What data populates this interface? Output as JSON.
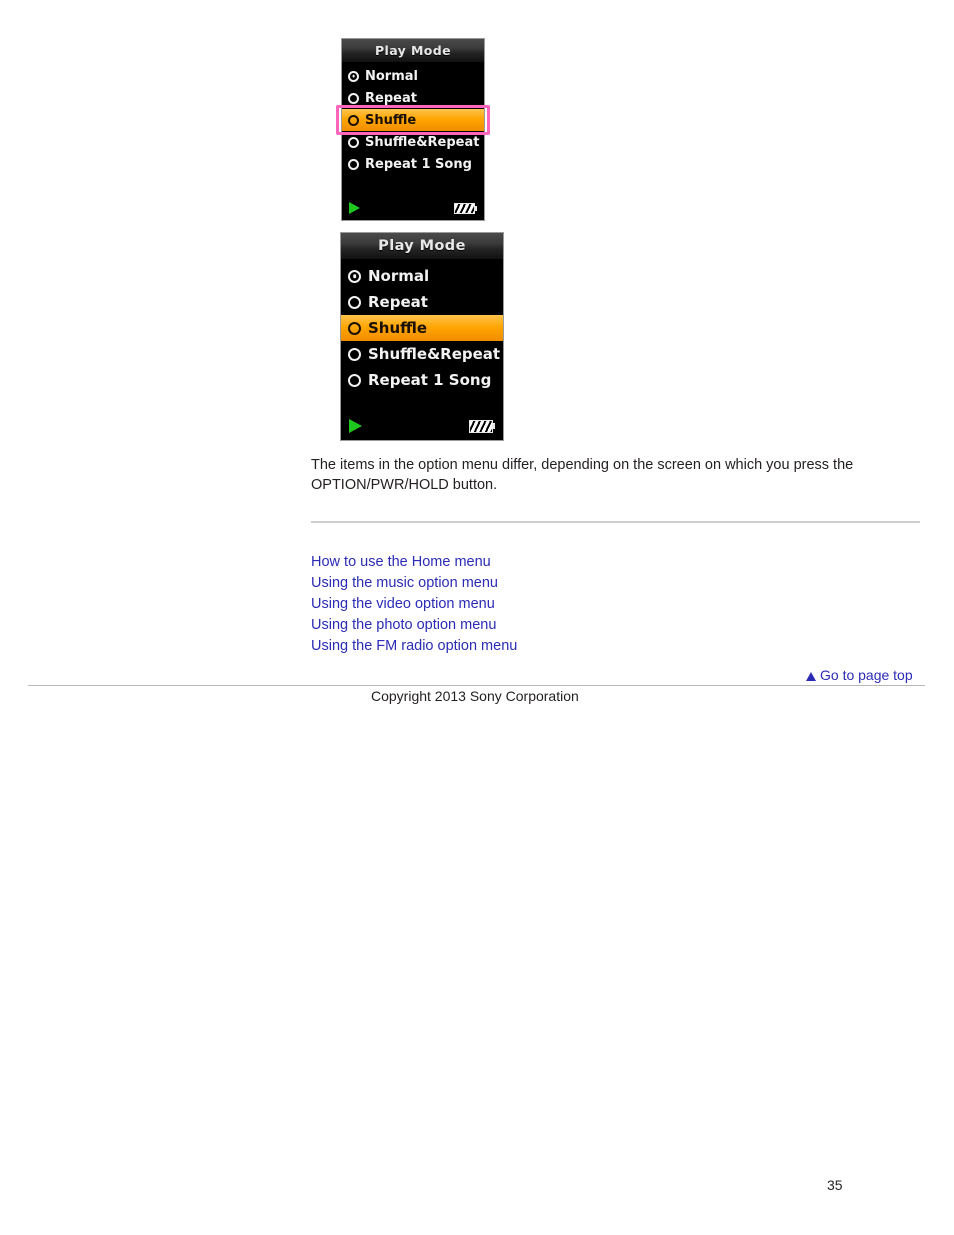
{
  "screens": [
    {
      "name": "play-mode-screen-highlighted",
      "title": "Play Mode",
      "items": [
        {
          "label": "Normal",
          "checked": true,
          "selected": false
        },
        {
          "label": "Repeat",
          "checked": false,
          "selected": false
        },
        {
          "label": "Shuffle",
          "checked": false,
          "selected": true
        },
        {
          "label": "Shuffle&Repeat",
          "checked": false,
          "selected": false
        },
        {
          "label": "Repeat 1 Song",
          "checked": false,
          "selected": false
        }
      ],
      "status": {
        "play_icon": "play-triangle-icon",
        "battery_icon": "battery-full-icon"
      },
      "callout_color": "#ff66bb"
    },
    {
      "name": "play-mode-screen-zoomed",
      "title": "Play Mode",
      "items": [
        {
          "label": "Normal",
          "checked": true,
          "selected": false
        },
        {
          "label": "Repeat",
          "checked": false,
          "selected": false
        },
        {
          "label": "Shuffle",
          "checked": false,
          "selected": true
        },
        {
          "label": "Shuffle&Repeat",
          "checked": false,
          "selected": false
        },
        {
          "label": "Repeat 1 Song",
          "checked": false,
          "selected": false
        }
      ],
      "status": {
        "play_icon": "play-triangle-icon",
        "battery_icon": "battery-full-icon"
      }
    }
  ],
  "note": {
    "line1": "The items in the option menu differ, depending on the screen on which you press the",
    "line2": "OPTION/PWR/HOLD button."
  },
  "related_links": [
    "How to use the Home menu",
    "Using the music option menu",
    "Using the video option menu",
    "Using the photo option menu",
    "Using the FM radio option menu"
  ],
  "footer": {
    "page_top_label": "Go to page top",
    "copyright": "Copyright 2013 Sony Corporation",
    "page_number": "35"
  },
  "colors": {
    "link": "#2b2bb5",
    "highlight": "#ffa500",
    "callout": "#ff66bb",
    "lcd_background": "#000000"
  }
}
